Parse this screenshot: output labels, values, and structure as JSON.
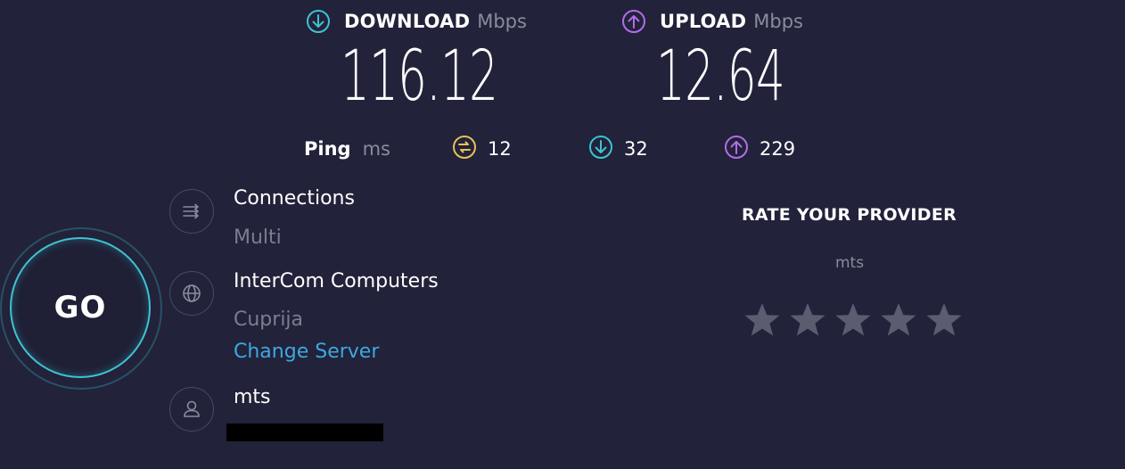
{
  "download": {
    "label": "DOWNLOAD",
    "unit": "Mbps",
    "value": "116.12",
    "color": "#3ec3d3",
    "icon": "arrow-down-circle-icon"
  },
  "upload": {
    "label": "UPLOAD",
    "unit": "Mbps",
    "value": "12.64",
    "color": "#b06ee8",
    "icon": "arrow-up-circle-icon"
  },
  "ping": {
    "label": "Ping",
    "unit": "ms",
    "idle": {
      "value": "12",
      "color": "#e5c25a",
      "icon": "idle-ping-icon"
    },
    "download": {
      "value": "32",
      "color": "#3ec3d3",
      "icon": "arrow-down-circle-icon"
    },
    "upload": {
      "value": "229",
      "color": "#b06ee8",
      "icon": "arrow-up-circle-icon"
    }
  },
  "go": {
    "label": "GO",
    "accent": "#3ec3d3"
  },
  "connections": {
    "title": "Connections",
    "value": "Multi",
    "icon": "connections-icon"
  },
  "server": {
    "name": "InterCom Computers",
    "location": "Cuprija",
    "change_label": "Change Server",
    "icon": "globe-icon",
    "link_color": "#3ea8e0"
  },
  "isp": {
    "name": "mts",
    "icon": "user-icon"
  },
  "rate": {
    "title": "RATE YOUR PROVIDER",
    "provider": "mts",
    "rating": 0,
    "max": 5,
    "star_color": "#5c5c70"
  }
}
